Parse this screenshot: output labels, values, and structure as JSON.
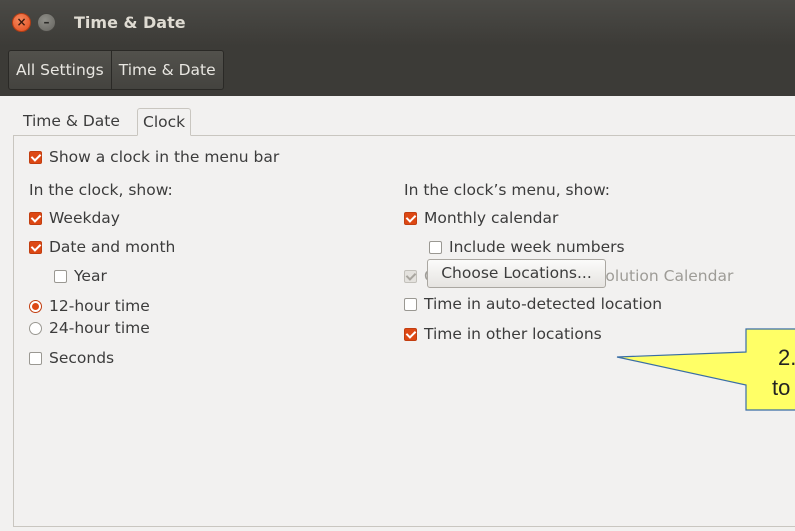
{
  "window": {
    "title": "Time & Date"
  },
  "breadcrumbs": [
    "All Settings",
    "Time & Date"
  ],
  "tabs": [
    {
      "label": "Time & Date",
      "active": false
    },
    {
      "label": "Clock",
      "active": true
    }
  ],
  "show_clock": {
    "label": "Show a clock in the menu bar",
    "checked": true
  },
  "left": {
    "heading": "In the clock, show:",
    "weekday": {
      "label": "Weekday",
      "checked": true
    },
    "date_month": {
      "label": "Date and month",
      "checked": true
    },
    "year": {
      "label": "Year",
      "checked": false
    },
    "twelve": {
      "label": "12-hour time",
      "selected": true
    },
    "twentyfour": {
      "label": "24-hour time",
      "selected": false
    },
    "seconds": {
      "label": "Seconds",
      "checked": false
    }
  },
  "right": {
    "heading": "In the clock’s menu, show:",
    "monthly": {
      "label": "Monthly calendar",
      "checked": true
    },
    "week_numbers": {
      "label": "Include week numbers",
      "checked": false
    },
    "events": {
      "label": "Coming events from Evolution Calendar",
      "checked": true,
      "disabled": true
    },
    "auto_location": {
      "label": "Time in auto-detected location",
      "checked": false
    },
    "other_locations": {
      "label": "Time in other locations",
      "checked": true
    },
    "choose_button": "Choose Locations..."
  },
  "callout": {
    "line1": "2.",
    "line2": "to",
    "fill": "#ffff66"
  },
  "colors": {
    "accent": "#dd4814",
    "titlebar": "#3c3b37"
  }
}
